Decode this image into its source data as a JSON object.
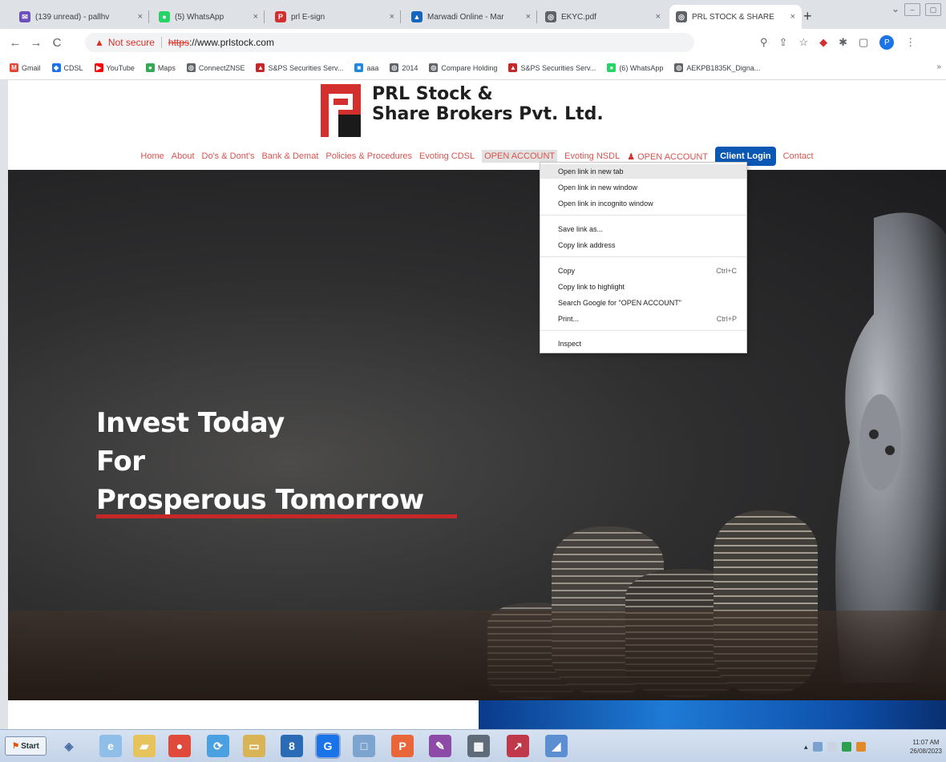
{
  "browser": {
    "tabs": [
      {
        "title": "(139 unread) - pallhv",
        "icon": "mail-icon",
        "color": "#6b4fbb",
        "glyph": "✉"
      },
      {
        "title": "(5) WhatsApp",
        "icon": "whatsapp-icon",
        "color": "#25d366",
        "glyph": "●"
      },
      {
        "title": "prl E-sign",
        "icon": "prl-icon",
        "color": "#d32f2f",
        "glyph": "P"
      },
      {
        "title": "Marwadi Online - Mar",
        "icon": "marwadi-icon",
        "color": "#1565c0",
        "glyph": "▲"
      },
      {
        "title": "EKYC.pdf",
        "icon": "globe-icon",
        "color": "#5f6368",
        "glyph": "◎"
      },
      {
        "title": "PRL STOCK & SHARE",
        "icon": "globe-icon",
        "color": "#5f6368",
        "glyph": "◎"
      }
    ],
    "active_tab_index": 5,
    "new_tab": "+",
    "url": {
      "security_label": "Not secure",
      "scheme": "https",
      "rest": "://www.prlstock.com"
    },
    "bookmarks": [
      {
        "label": "Gmail",
        "icon": "gmail-icon",
        "color": "#ea4335",
        "glyph": "M"
      },
      {
        "label": "CDSL",
        "icon": "cdsl-icon",
        "color": "#1a73e8",
        "glyph": "◆"
      },
      {
        "label": "YouTube",
        "icon": "youtube-icon",
        "color": "#ff0000",
        "glyph": "▶"
      },
      {
        "label": "Maps",
        "icon": "maps-icon",
        "color": "#34a853",
        "glyph": "●"
      },
      {
        "label": "ConnectZNSE",
        "icon": "globe-icon",
        "color": "#5f6368",
        "glyph": "◎"
      },
      {
        "label": "S&PS Securities Serv...",
        "icon": "sps-icon",
        "color": "#c62828",
        "glyph": "▲"
      },
      {
        "label": "aaa",
        "icon": "bookmark-icon",
        "color": "#1e88e5",
        "glyph": "■"
      },
      {
        "label": "2014",
        "icon": "globe-icon",
        "color": "#5f6368",
        "glyph": "◎"
      },
      {
        "label": "Compare Holding",
        "icon": "globe-icon",
        "color": "#5f6368",
        "glyph": "◎"
      },
      {
        "label": "S&PS Securities Serv...",
        "icon": "sps-icon",
        "color": "#c62828",
        "glyph": "▲"
      },
      {
        "label": "(6) WhatsApp",
        "icon": "whatsapp-icon",
        "color": "#25d366",
        "glyph": "●"
      },
      {
        "label": "AEKPB1835K_Digna...",
        "icon": "globe-icon",
        "color": "#5f6368",
        "glyph": "◎"
      }
    ]
  },
  "site": {
    "logo": {
      "line1": "PRL Stock &",
      "line2": "Share Brokers Pvt. Ltd."
    },
    "nav": [
      {
        "label": "Home",
        "hl": false
      },
      {
        "label": "About",
        "hl": false
      },
      {
        "label": "Do's & Dont's",
        "hl": false
      },
      {
        "label": "Bank & Demat",
        "hl": false
      },
      {
        "label": "Policies & Procedures",
        "hl": false
      },
      {
        "label": "Evoting CDSL",
        "hl": false
      },
      {
        "label": "OPEN ACCOUNT",
        "hl": true
      },
      {
        "label": "Evoting NSDL",
        "hl": false
      }
    ],
    "nav_open_account": "OPEN ACCOUNT",
    "nav_client_login": "Client Login",
    "nav_contact": "Contact",
    "hero": {
      "line1": "Invest Today",
      "line2": "For",
      "line3": "Prosperous Tomorrow"
    }
  },
  "context_menu": {
    "items": [
      {
        "label": "Open link in new tab",
        "shortcut": "",
        "selected": true
      },
      {
        "label": "Open link in new window",
        "shortcut": ""
      },
      {
        "label": "Open link in incognito window",
        "shortcut": ""
      },
      {
        "label": "Save link as...",
        "shortcut": ""
      },
      {
        "label": "Copy link address",
        "shortcut": ""
      },
      {
        "label": "Copy",
        "shortcut": "Ctrl+C"
      },
      {
        "label": "Copy link to highlight",
        "shortcut": ""
      },
      {
        "label": "Search Google for \"OPEN ACCOUNT\"",
        "shortcut": ""
      },
      {
        "label": "Print...",
        "shortcut": "Ctrl+P"
      },
      {
        "label": "Inspect",
        "shortcut": ""
      }
    ]
  },
  "taskbar": {
    "start_label": "Start",
    "clock_time": "11:07 AM",
    "clock_date": "26/08/2023"
  },
  "colors": {
    "brand_red": "#d32f2f",
    "nav_text": "#d9534f",
    "login_blue": "#0b57b4"
  }
}
